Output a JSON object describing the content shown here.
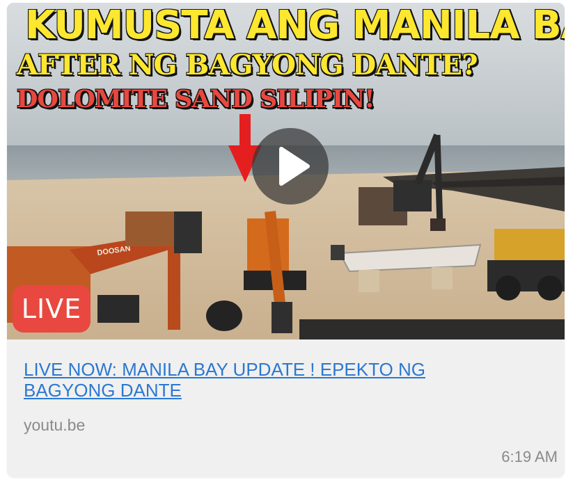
{
  "thumbnail": {
    "headline_line1": "KUMUSTA ANG MANILA BAY",
    "headline_line2": "AFTER NG BAGYONG DANTE?",
    "headline_line3": "DOLOMITE SAND SILIPIN!",
    "badge": "LIVE",
    "machine_brand": "DOOSAN",
    "play_icon": "play-icon"
  },
  "link_preview": {
    "title": "LIVE NOW: MANILA BAY UPDATE ! EPEKTO NG BAGYONG DANTE",
    "domain": "youtu.be"
  },
  "message": {
    "time": "6:19 AM"
  },
  "colors": {
    "headline_yellow": "#fde72f",
    "headline_red": "#e8483f",
    "link_blue": "#2b78d2",
    "meta_gray": "#8a8a8a",
    "card_bg": "#f0f0f0"
  }
}
